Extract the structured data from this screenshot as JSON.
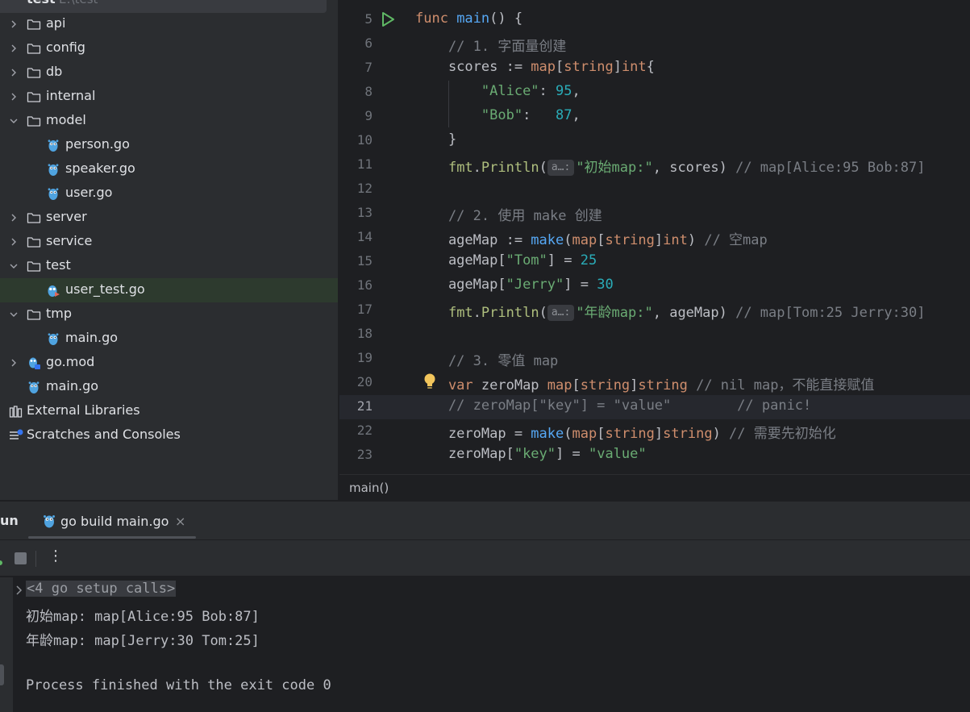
{
  "project": {
    "root": {
      "name": "test",
      "path": "E:\\test"
    },
    "items": [
      {
        "label": "api",
        "type": "folder",
        "expanded": false
      },
      {
        "label": "config",
        "type": "folder",
        "expanded": false
      },
      {
        "label": "db",
        "type": "folder",
        "expanded": false
      },
      {
        "label": "internal",
        "type": "folder",
        "expanded": false
      },
      {
        "label": "model",
        "type": "folder",
        "expanded": true
      },
      {
        "label": "person.go",
        "type": "go-file"
      },
      {
        "label": "speaker.go",
        "type": "go-file"
      },
      {
        "label": "user.go",
        "type": "go-file"
      },
      {
        "label": "server",
        "type": "folder",
        "expanded": false
      },
      {
        "label": "service",
        "type": "folder",
        "expanded": false
      },
      {
        "label": "test",
        "type": "folder",
        "expanded": true
      },
      {
        "label": "user_test.go",
        "type": "go-test-file",
        "selected": true
      },
      {
        "label": "tmp",
        "type": "folder",
        "expanded": true
      },
      {
        "label": "main.go",
        "type": "go-file"
      },
      {
        "label": "go.mod",
        "type": "go-mod-file",
        "expanded": false
      },
      {
        "label": "main.go",
        "type": "go-file"
      },
      {
        "label": "External Libraries",
        "type": "libraries"
      },
      {
        "label": "Scratches and Consoles",
        "type": "scratches"
      }
    ]
  },
  "editor": {
    "lines": [
      {
        "n": "5",
        "tokens": [
          [
            "kw",
            "func "
          ],
          [
            "fn",
            "main"
          ],
          [
            "",
            "() {"
          ]
        ]
      },
      {
        "n": "6",
        "tokens": [
          [
            "cm",
            "    // 1. 字面量创建"
          ]
        ]
      },
      {
        "n": "7",
        "tokens": [
          [
            "",
            "    scores := "
          ],
          [
            "kw",
            "map"
          ],
          [
            "",
            "["
          ],
          [
            "kw",
            "string"
          ],
          [
            "",
            "]"
          ],
          [
            "kw",
            "int"
          ],
          [
            "",
            "{"
          ]
        ]
      },
      {
        "n": "8",
        "tokens": [
          [
            "",
            "        "
          ],
          [
            "str",
            "\"Alice\""
          ],
          [
            "",
            ": "
          ],
          [
            "num",
            "95"
          ],
          [
            "",
            ","
          ]
        ]
      },
      {
        "n": "9",
        "tokens": [
          [
            "",
            "        "
          ],
          [
            "str",
            "\"Bob\""
          ],
          [
            "",
            ":   "
          ],
          [
            "num",
            "87"
          ],
          [
            "",
            ","
          ]
        ]
      },
      {
        "n": "10",
        "tokens": [
          [
            "",
            "    }"
          ]
        ]
      },
      {
        "n": "11",
        "tokens": [
          [
            "",
            "    "
          ],
          [
            "pkg",
            "fmt"
          ],
          [
            "",
            "."
          ],
          [
            "pkg",
            "Println"
          ],
          [
            "",
            "("
          ],
          [
            "hint",
            "a…:"
          ],
          [
            "str",
            "\"初始map:\""
          ],
          [
            "",
            ", scores) "
          ],
          [
            "cm",
            "// map[Alice:95 Bob:87]"
          ]
        ]
      },
      {
        "n": "12",
        "tokens": []
      },
      {
        "n": "13",
        "tokens": [
          [
            "cm",
            "    // 2. 使用 make 创建"
          ]
        ]
      },
      {
        "n": "14",
        "tokens": [
          [
            "",
            "    ageMap := "
          ],
          [
            "fn",
            "make"
          ],
          [
            "",
            "("
          ],
          [
            "kw",
            "map"
          ],
          [
            "",
            "["
          ],
          [
            "kw",
            "string"
          ],
          [
            "",
            "]"
          ],
          [
            "kw",
            "int"
          ],
          [
            "",
            ") "
          ],
          [
            "cm",
            "// 空map"
          ]
        ]
      },
      {
        "n": "15",
        "tokens": [
          [
            "",
            "    ageMap["
          ],
          [
            "str",
            "\"Tom\""
          ],
          [
            "",
            "] = "
          ],
          [
            "num",
            "25"
          ]
        ]
      },
      {
        "n": "16",
        "tokens": [
          [
            "",
            "    ageMap["
          ],
          [
            "str",
            "\"Jerry\""
          ],
          [
            "",
            "] = "
          ],
          [
            "num",
            "30"
          ]
        ]
      },
      {
        "n": "17",
        "tokens": [
          [
            "",
            "    "
          ],
          [
            "pkg",
            "fmt"
          ],
          [
            "",
            "."
          ],
          [
            "pkg",
            "Println"
          ],
          [
            "",
            "("
          ],
          [
            "hint",
            "a…:"
          ],
          [
            "str",
            "\"年龄map:\""
          ],
          [
            "",
            ", ageMap) "
          ],
          [
            "cm",
            "// map[Tom:25 Jerry:30]"
          ]
        ]
      },
      {
        "n": "18",
        "tokens": []
      },
      {
        "n": "19",
        "tokens": [
          [
            "cm",
            "    // 3. 零值 map"
          ]
        ]
      },
      {
        "n": "20",
        "tokens": [
          [
            "kw",
            "    var "
          ],
          [
            "",
            "zeroMap "
          ],
          [
            "kw",
            "map"
          ],
          [
            "",
            "["
          ],
          [
            "kw",
            "string"
          ],
          [
            "",
            "]"
          ],
          [
            "kw",
            "string"
          ],
          [
            "cm",
            " // nil map，不能直接赋值"
          ]
        ]
      },
      {
        "n": "21",
        "tokens": [
          [
            "cm",
            "    // zeroMap[\"key\"] = \"value\"        // panic!"
          ]
        ]
      },
      {
        "n": "22",
        "tokens": [
          [
            "",
            "    zeroMap = "
          ],
          [
            "fn",
            "make"
          ],
          [
            "",
            "("
          ],
          [
            "kw",
            "map"
          ],
          [
            "",
            "["
          ],
          [
            "kw",
            "string"
          ],
          [
            "",
            "]"
          ],
          [
            "kw",
            "string"
          ],
          [
            "",
            ") "
          ],
          [
            "cm",
            "// 需要先初始化"
          ]
        ]
      },
      {
        "n": "23",
        "tokens": [
          [
            "",
            "    zeroMap["
          ],
          [
            "str",
            "\"key\""
          ],
          [
            "",
            "] = "
          ],
          [
            "str",
            "\"value\""
          ]
        ]
      }
    ],
    "current_line": "21",
    "breadcrumb": "main()"
  },
  "run_panel": {
    "title": "un",
    "tab_label": "go build main.go",
    "tab_close": "×",
    "more_label": "⋮",
    "console": {
      "setup_calls": "<4 go setup calls>",
      "lines": [
        "初始map: map[Alice:95 Bob:87]",
        "年龄map: map[Jerry:30 Tom:25]",
        "",
        "Process finished with the exit code 0"
      ]
    }
  },
  "colors": {
    "keyword": "#cf8e6d",
    "function": "#56a8f5",
    "string": "#6aab73",
    "number": "#2aacb8",
    "comment": "#7a7e85",
    "package": "#afbf7e",
    "folder_icon": "#ced0d6",
    "gopher": "#4fa3e0",
    "run_green": "#5fb865"
  },
  "icons": [
    "chevron-right-icon",
    "chevron-down-icon",
    "folder-icon",
    "gopher-icon",
    "go-mod-icon",
    "libraries-icon",
    "scratches-icon",
    "run-icon",
    "bulb-icon",
    "stop-icon",
    "more-icon",
    "close-icon"
  ]
}
